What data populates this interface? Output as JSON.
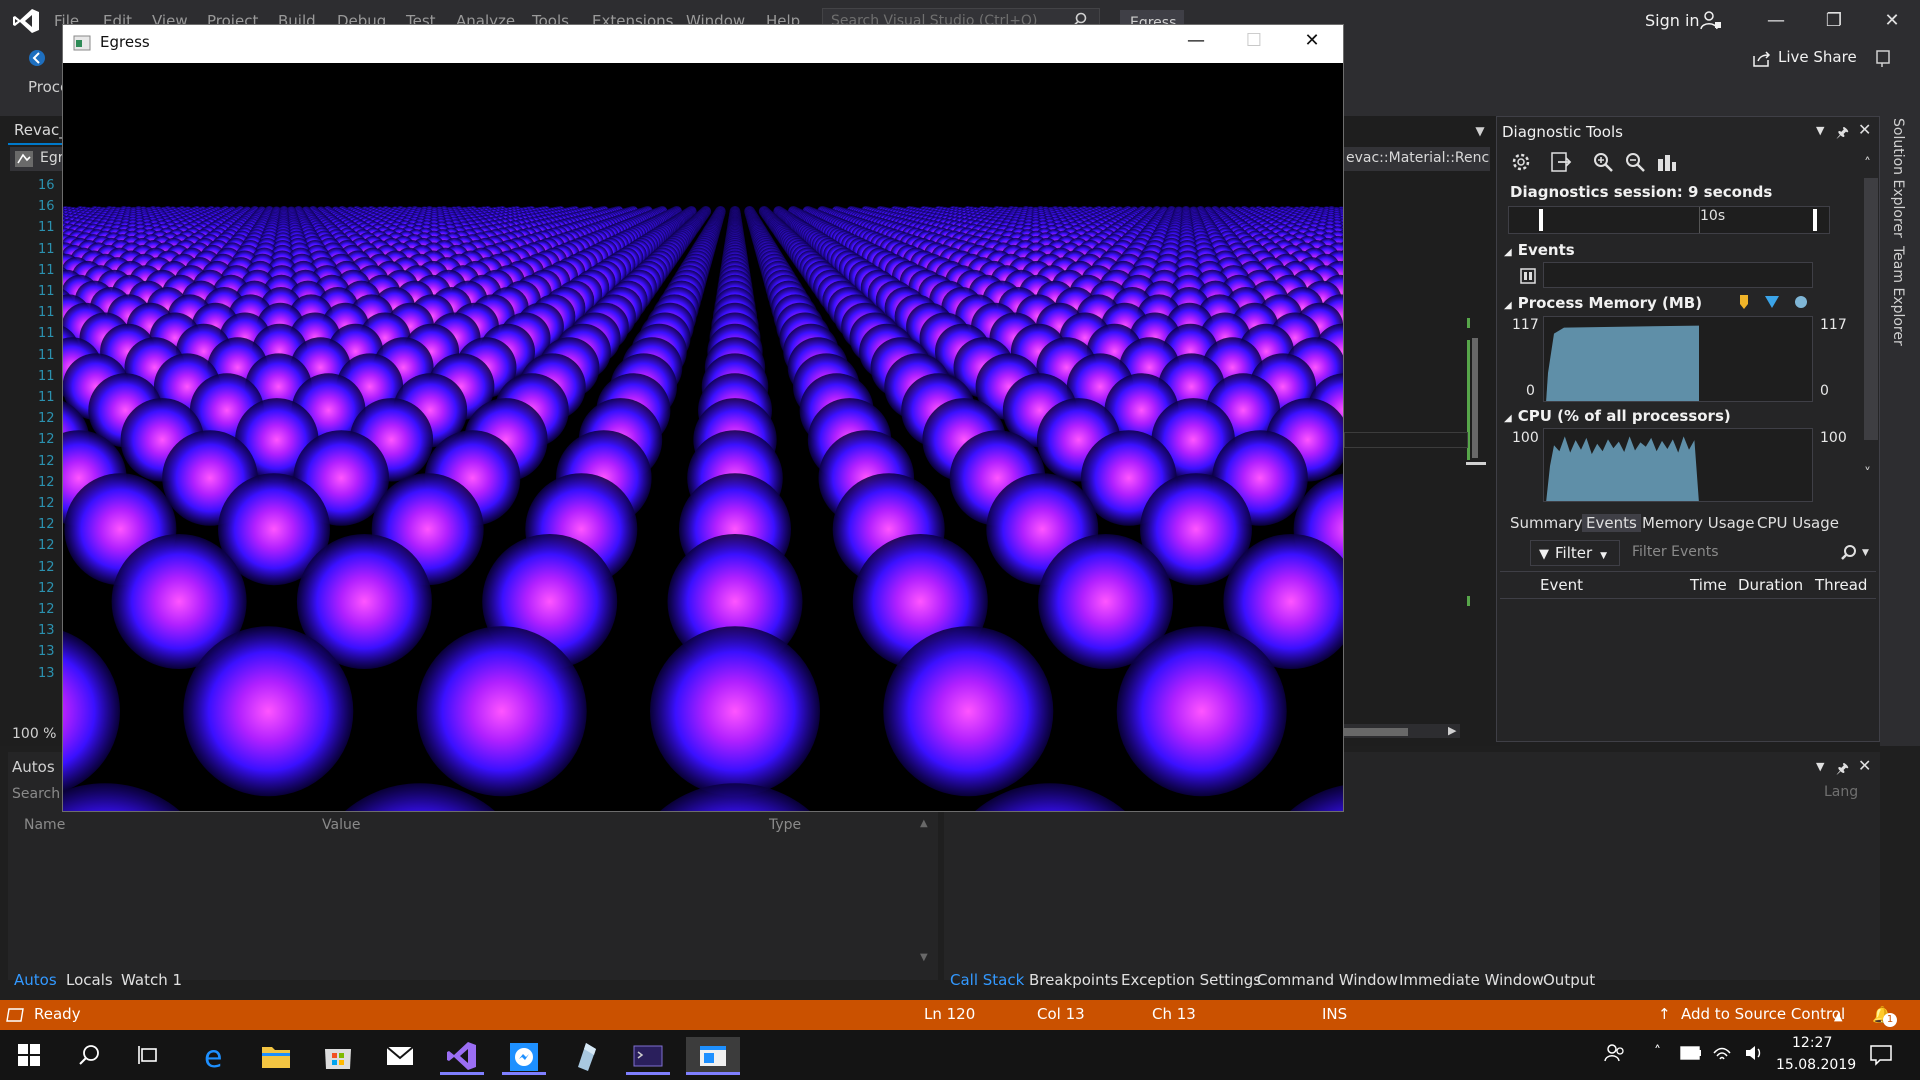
{
  "vs": {
    "menu": [
      "File",
      "Edit",
      "View",
      "Project",
      "Build",
      "Debug",
      "Test",
      "Analyze",
      "Tools",
      "Extensions",
      "Window",
      "Help"
    ],
    "search_placeholder": "Search Visual Studio (Ctrl+Q)",
    "project_badge": "Egress",
    "sign_in": "Sign in",
    "live_share": "Live Share",
    "process_label": "Proce",
    "doc_tab": "Revac_",
    "nav_combo_left": "Egr",
    "nav_combo_right": "evac::Material::Renc",
    "line_numbers": [
      "16",
      "16",
      "11",
      "11",
      "11",
      "11",
      "11",
      "11",
      "11",
      "11",
      "11",
      "12",
      "12",
      "12",
      "12",
      "12",
      "12",
      "12",
      "12",
      "12",
      "12",
      "13",
      "13",
      "13"
    ],
    "zoom": "100 %"
  },
  "diagnostic": {
    "title": "Diagnostic Tools",
    "session": "Diagnostics session: 9 seconds",
    "ruler_label": "10s",
    "events_label": "Events",
    "memory_label": "Process Memory (MB)",
    "memory_max": "117",
    "memory_min": "0",
    "cpu_label": "CPU (% of all processors)",
    "cpu_max": "100",
    "cpu_min": "0",
    "tabs": [
      "Summary",
      "Events",
      "Memory Usage",
      "CPU Usage"
    ],
    "active_tab": "Events",
    "filter_label": "Filter",
    "filter_placeholder": "Filter Events",
    "columns": [
      "Event",
      "Time",
      "Duration",
      "Thread"
    ],
    "memory_level": 0.9,
    "cpu_level": 0.88
  },
  "side_tabs": [
    "Solution Explorer",
    "Team Explorer"
  ],
  "autos": {
    "title": "Autos",
    "search": "Search",
    "columns": [
      "Name",
      "Value",
      "Type"
    ],
    "tabs": [
      "Autos",
      "Locals",
      "Watch 1"
    ],
    "active_tab": "Autos"
  },
  "right_panel": {
    "lang_column": "Lang",
    "tabs": [
      "Call Stack",
      "Breakpoints",
      "Exception Settings",
      "Command Window",
      "Immediate Window",
      "Output"
    ],
    "active_tab": "Call Stack"
  },
  "status": {
    "ready": "Ready",
    "ln": "Ln 120",
    "col": "Col 13",
    "ch": "Ch 13",
    "ins": "INS",
    "source_control": "Add to Source Control",
    "notification_count": "1"
  },
  "egress": {
    "title": "Egress"
  },
  "taskbar": {
    "time": "12:27",
    "date": "15.08.2019"
  },
  "colors": {
    "vs_bg": "#2d2d30",
    "accent": "#007acc",
    "status_bar": "#ca5100",
    "sphere_core": "#ff40ff",
    "sphere_edge": "#2a00ff",
    "graph_fill": "#5f8fa8"
  }
}
